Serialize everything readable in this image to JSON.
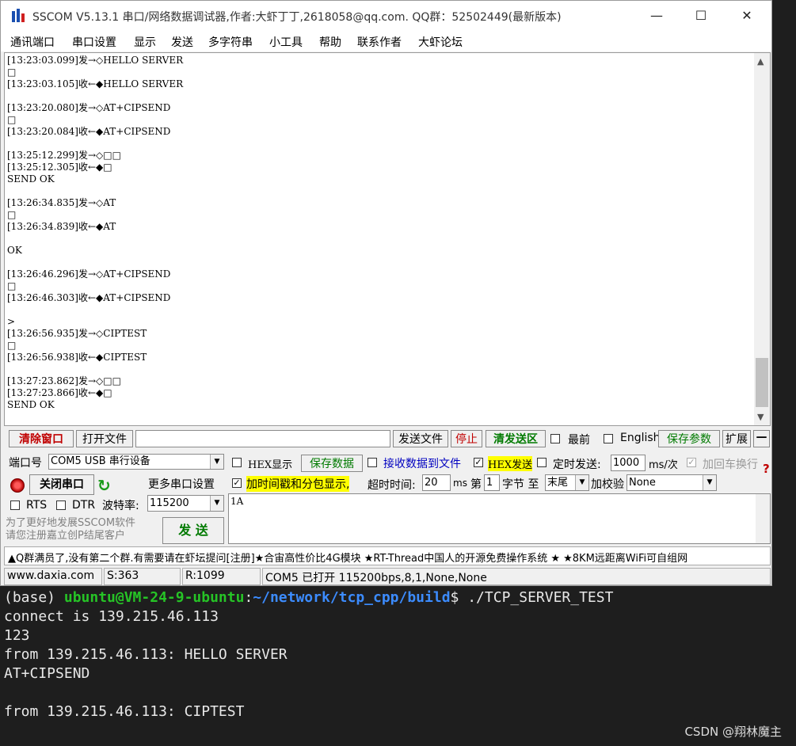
{
  "window": {
    "title": "SSCOM V5.13.1 串口/网络数据调试器,作者:大虾丁丁,2618058@qq.com. QQ群：52502449(最新版本)",
    "minimize": "—",
    "maximize": "☐",
    "close": "✕"
  },
  "menu": [
    "通讯端口",
    "串口设置",
    "显示",
    "发送",
    "多字符串",
    "小工具",
    "帮助",
    "联系作者",
    "大虾论坛"
  ],
  "receive_log": [
    "[13:23:03.099]发→◇HELLO SERVER",
    "□",
    "[13:23:03.105]收←◆HELLO SERVER",
    "",
    "[13:23:20.080]发→◇AT+CIPSEND",
    "□",
    "[13:23:20.084]收←◆AT+CIPSEND",
    "",
    "[13:25:12.299]发→◇□□",
    "[13:25:12.305]收←◆□",
    "SEND OK",
    "",
    "[13:26:34.835]发→◇AT",
    "□",
    "[13:26:34.839]收←◆AT",
    "",
    "OK",
    "",
    "[13:26:46.296]发→◇AT+CIPSEND",
    "□",
    "[13:26:46.303]收←◆AT+CIPSEND",
    "",
    ">",
    "[13:26:56.935]发→◇CIPTEST",
    "□",
    "[13:26:56.938]收←◆CIPTEST",
    "",
    "[13:27:23.862]发→◇□□",
    "[13:27:23.866]收←◆□",
    "SEND OK"
  ],
  "toolbar": {
    "clear_window": "清除窗口",
    "open_file": "打开文件",
    "file_path": "",
    "send_file": "发送文件",
    "stop": "停止",
    "clear_send": "清发送区",
    "topmost": "最前",
    "english": "English",
    "save_params": "保存参数",
    "expand": "扩展",
    "collapse": "—"
  },
  "port": {
    "port_label": "端口号",
    "port_value": "COM5 USB 串行设备",
    "close_port": "关闭串口",
    "more_settings": "更多串口设置",
    "rts": "RTS",
    "dtr": "DTR",
    "baud_label": "波特率:",
    "baud_value": "115200",
    "promo": "为了更好地发展SSCOM软件\n请您注册嘉立创P结尾客户",
    "send_button": "发 送"
  },
  "options": {
    "hex_display": "HEX显示",
    "save_data": "保存数据",
    "recv_to_file": "接收数据到文件",
    "hex_send": "HEX发送",
    "timed_send": "定时发送:",
    "timed_value": "1000",
    "ms_per": "ms/次",
    "add_crlf": "加回车换行",
    "add_timestamp": "加时间戳和分包显示,",
    "timeout_label": "超时时间:",
    "timeout_value": "20",
    "ms": "ms",
    "nth": "第",
    "byte_index": "1",
    "byte_to": "字节 至",
    "byte_end": "末尾",
    "checksum_label": "加校验",
    "checksum_value": "None",
    "help": "?"
  },
  "send_area": {
    "value": "1A"
  },
  "ticker": "▲Q群满员了,没有第二个群.有需要请在虾坛提问[注册]★合宙高性价比4G模块 ★RT-Thread中国人的开源免费操作系统 ★ ★8KM远距离WiFi可自组网",
  "statusbar": {
    "site": "www.daxia.com",
    "sent": "S:363",
    "recv": "R:1099",
    "port_status": "COM5 已打开  115200bps,8,1,None,None"
  },
  "terminal": {
    "prompt_prefix": "(base) ",
    "user_host": "ubuntu@VM-24-9-ubuntu",
    "colon": ":",
    "path": "~/network/tcp_cpp/build",
    "prompt_symbol": "$ ",
    "command": "./TCP_SERVER_TEST",
    "output": [
      "connect is 139.215.46.113",
      "123",
      "from 139.215.46.113: HELLO SERVER",
      "AT+CIPSEND",
      "",
      "from 139.215.46.113: CIPTEST"
    ]
  },
  "watermark": "CSDN @翔林魔主",
  "colors": {
    "accent_red": "#c00000",
    "accent_green": "#007a00",
    "terminal_green": "#26c426",
    "terminal_blue": "#3c8cff",
    "highlight": "#ffff00"
  }
}
